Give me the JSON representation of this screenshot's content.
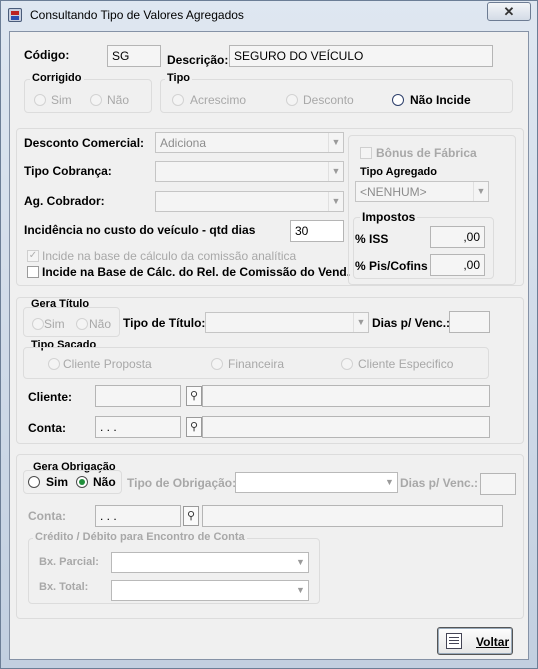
{
  "window": {
    "title": "Consultando Tipo de Valores Agregados",
    "close_label": "✕"
  },
  "header": {
    "codigo_label": "Código:",
    "codigo_value": "SG",
    "descricao_label": "Descrição:",
    "descricao_value": "SEGURO DO VEÍCULO"
  },
  "corrigido": {
    "label": "Corrigido",
    "options": [
      "Sim",
      "Não"
    ]
  },
  "tipo": {
    "label": "Tipo",
    "options": [
      "Acrescimo",
      "Desconto",
      "Não Incide"
    ],
    "selected": "Não Incide"
  },
  "desconto": {
    "desconto_comercial_label": "Desconto Comercial:",
    "desconto_comercial_value": "Adiciona",
    "tipo_cobranca_label": "Tipo Cobrança:",
    "tipo_cobranca_value": "",
    "ag_cobrador_label": "Ag. Cobrador:",
    "ag_cobrador_value": "",
    "incidencia_label": "Incidência no custo do veículo - qtd dias",
    "incidencia_value": "30",
    "incide_comissao_label": "Incide na base de cálculo da comissão analítica",
    "incide_rel_comissao_label": "Incide na Base de Cálc. do Rel. de Comissão do Vend."
  },
  "side": {
    "bonus_label": "Bônus de Fábrica",
    "tipo_agregado_label": "Tipo Agregado",
    "tipo_agregado_value": "<NENHUM>",
    "impostos_label": "Impostos",
    "iss_label": "% ISS",
    "iss_value": ",00",
    "pis_label": "% Pis/Cofins",
    "pis_value": ",00"
  },
  "titulo": {
    "gera_titulo_label": "Gera Título",
    "gera_options": [
      "Sim",
      "Não"
    ],
    "tipo_titulo_label": "Tipo de Título:",
    "tipo_titulo_value": "",
    "dias_label": "Dias p/ Venc.:",
    "dias_value": "",
    "tipo_sacado_label": "Tipo Sacado",
    "sacado_options": [
      "Cliente Proposta",
      "Financeira",
      "Cliente Especifico"
    ],
    "cliente_label": "Cliente:",
    "cliente_code": "",
    "cliente_name": "",
    "conta_label": "Conta:",
    "conta_code": ". . .",
    "conta_name": ""
  },
  "obrigacao": {
    "gera_label": "Gera Obrigação",
    "options": [
      "Sim",
      "Não"
    ],
    "selected": "Não",
    "tipo_label": "Tipo de Obrigação:",
    "tipo_value": "",
    "dias_label": "Dias p/ Venc.:",
    "dias_value": "",
    "conta_label": "Conta:",
    "conta_code": ". . .",
    "conta_name": "",
    "credito_label": "Crédito / Débito para Encontro de Conta",
    "bx_parcial_label": "Bx. Parcial:",
    "bx_parcial_value": "",
    "bx_total_label": "Bx. Total:",
    "bx_total_value": ""
  },
  "footer": {
    "voltar_label": "Voltar"
  },
  "colors": {
    "accent_radio": "#1f8f3a",
    "window_frame": "#c2cfe0",
    "panel": "#f0f0f0"
  }
}
